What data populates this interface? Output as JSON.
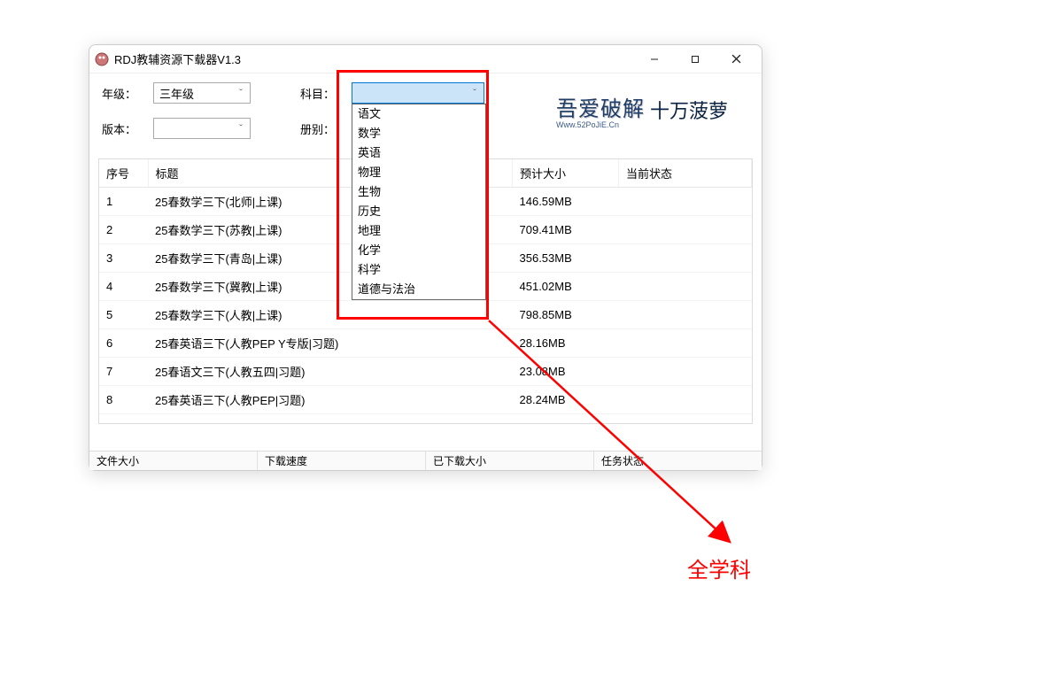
{
  "window": {
    "title": "RDJ教辅资源下载器V1.3"
  },
  "filters": {
    "grade_label": "年级：",
    "grade_value": "三年级",
    "subject_label": "科目：",
    "subject_value": "",
    "version_label": "版本：",
    "version_value": "",
    "volume_label": "册别：",
    "volume_value": ""
  },
  "subject_options": [
    "语文",
    "数学",
    "英语",
    "物理",
    "生物",
    "历史",
    "地理",
    "化学",
    "科学",
    "道德与法治"
  ],
  "logo": {
    "main": "吾爱破解",
    "sub": "Www.52PoJiE.Cn",
    "right": "十万菠萝"
  },
  "table": {
    "headers": {
      "idx": "序号",
      "title": "标题",
      "size": "预计大小",
      "status": "当前状态"
    },
    "rows": [
      {
        "idx": "1",
        "title": "25春数学三下(北师|上课)",
        "size": "146.59MB",
        "status": ""
      },
      {
        "idx": "2",
        "title": "25春数学三下(苏教|上课)",
        "size": "709.41MB",
        "status": ""
      },
      {
        "idx": "3",
        "title": "25春数学三下(青岛|上课)",
        "size": "356.53MB",
        "status": ""
      },
      {
        "idx": "4",
        "title": "25春数学三下(冀教|上课)",
        "size": "451.02MB",
        "status": ""
      },
      {
        "idx": "5",
        "title": "25春数学三下(人教|上课)",
        "size": "798.85MB",
        "status": ""
      },
      {
        "idx": "6",
        "title": "25春英语三下(人教PEP Y专版|习题)",
        "size": "28.16MB",
        "status": ""
      },
      {
        "idx": "7",
        "title": "25春语文三下(人教五四|习题)",
        "size": "23.08MB",
        "status": ""
      },
      {
        "idx": "8",
        "title": "25春英语三下(人教PEP|习题)",
        "size": "28.24MB",
        "status": ""
      }
    ]
  },
  "statusbar": {
    "file_size": "文件大小",
    "dl_speed": "下载速度",
    "dl_size": "已下载大小",
    "task_status": "任务状态"
  },
  "annotation": {
    "label": "全学科"
  }
}
